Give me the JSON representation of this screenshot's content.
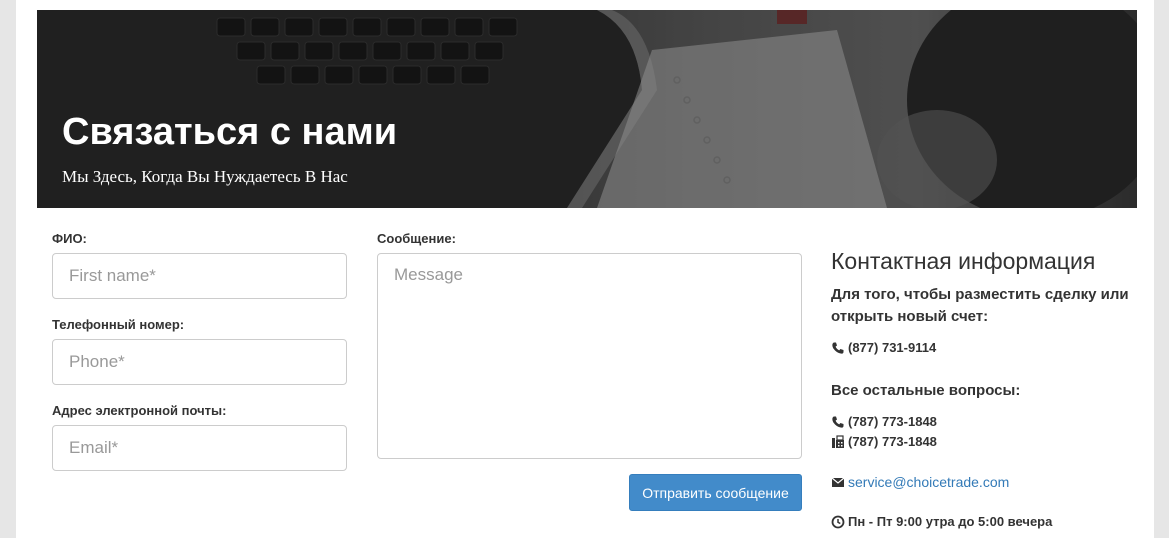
{
  "hero": {
    "title": "Связаться с нами",
    "subtitle": "Мы Здесь, Когда Вы Нуждаетесь В Нас"
  },
  "form": {
    "name_label": "ФИО:",
    "name_placeholder": "First name*",
    "phone_label": "Телефонный номер:",
    "phone_placeholder": "Phone*",
    "email_label": "Адрес электронной почты:",
    "email_placeholder": "Email*",
    "message_label": "Сообщение:",
    "message_placeholder": "Message",
    "submit_label": "Отправить сообщение"
  },
  "contact": {
    "title": "Контактная информация",
    "trade_text": "Для того, чтобы разместить сделку или открыть новый счет:",
    "trade_phone": "(877) 731-9114",
    "other_text": "Все остальные вопросы:",
    "other_phone": "(787) 773-1848",
    "fax": "(787) 773-1848",
    "email": "service@choicetrade.com",
    "hours": "Пн - Пт 9:00 утра до 5:00 вечера"
  },
  "colors": {
    "primary_button": "#428bca",
    "link": "#337ab7",
    "text": "#333333"
  },
  "icons": {
    "trade_phone": "phone-icon",
    "other_phone": "phone-icon",
    "fax": "fax-icon",
    "email": "envelope-icon",
    "hours": "clock-icon"
  }
}
